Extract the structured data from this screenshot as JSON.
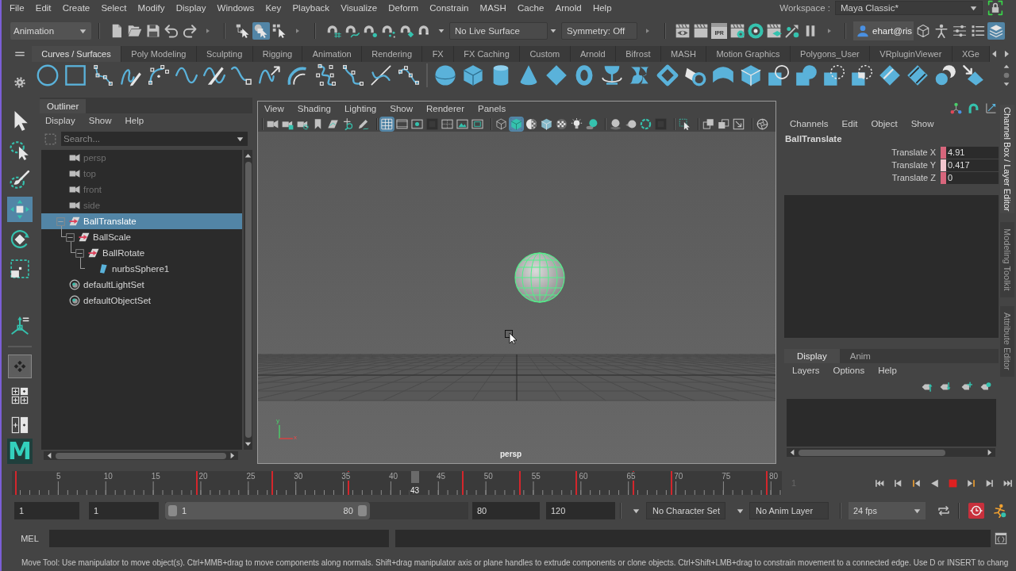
{
  "menu_bar": {
    "items": [
      "File",
      "Edit",
      "Create",
      "Select",
      "Modify",
      "Display",
      "Windows",
      "Key",
      "Playback",
      "Visualize",
      "Deform",
      "Constrain",
      "MASH",
      "Cache",
      "Arnold",
      "Help"
    ],
    "workspace_label": "Workspace :",
    "workspace": "Maya Classic*"
  },
  "status_line": {
    "menu_set": "Animation",
    "selection_modes": [
      {
        "kind": "hierarchy",
        "selected": false
      },
      {
        "kind": "object",
        "selected": true
      },
      {
        "kind": "component",
        "selected": false
      }
    ],
    "live_surface": "No Live Surface",
    "symmetry": "Symmetry: Off",
    "ipr_label": "IPR",
    "user": "ehart@ris",
    "panel_toggles": [
      {
        "kind": "toolkit",
        "selected": false
      },
      {
        "kind": "character",
        "selected": false
      },
      {
        "kind": "attributes",
        "selected": false
      },
      {
        "kind": "settings",
        "selected": false
      },
      {
        "kind": "channels",
        "selected": true
      }
    ]
  },
  "shelf": {
    "tabs": [
      {
        "label": "Curves / Surfaces",
        "selected": true
      },
      {
        "label": "Poly Modeling",
        "selected": false
      },
      {
        "label": "Sculpting",
        "selected": false
      },
      {
        "label": "Rigging",
        "selected": false
      },
      {
        "label": "Animation",
        "selected": false
      },
      {
        "label": "Rendering",
        "selected": false
      },
      {
        "label": "FX",
        "selected": false
      },
      {
        "label": "FX Caching",
        "selected": false
      },
      {
        "label": "Custom",
        "selected": false
      },
      {
        "label": "Arnold",
        "selected": false
      },
      {
        "label": "Bifrost",
        "selected": false
      },
      {
        "label": "MASH",
        "selected": false
      },
      {
        "label": "Motion Graphics",
        "selected": false
      },
      {
        "label": "Polygons_User",
        "selected": false
      },
      {
        "label": "VRpluginViewer",
        "selected": false
      },
      {
        "label": "XGe",
        "selected": false
      }
    ]
  },
  "toolbox": {
    "tools": [
      {
        "kind": "select",
        "selected": false
      },
      {
        "kind": "lasso",
        "selected": false
      },
      {
        "kind": "paint",
        "selected": false
      },
      {
        "kind": "move",
        "selected": true
      },
      {
        "kind": "rotate",
        "selected": false
      },
      {
        "kind": "scale",
        "selected": false
      }
    ],
    "layouts": [
      {
        "kind": "single",
        "selected": true
      },
      {
        "kind": "quad",
        "selected": false
      },
      {
        "kind": "split",
        "selected": false
      }
    ],
    "logo": "M"
  },
  "outliner": {
    "title": "Outliner",
    "menu": [
      "Display",
      "Show",
      "Help"
    ],
    "search": {
      "placeholder": "Search..."
    },
    "tree": [
      {
        "label": "persp",
        "kind": "camera",
        "selected": false,
        "disabled": true,
        "expanded": false
      },
      {
        "label": "top",
        "kind": "camera",
        "selected": false,
        "disabled": true,
        "expanded": false
      },
      {
        "label": "front",
        "kind": "camera",
        "selected": false,
        "disabled": true,
        "expanded": false
      },
      {
        "label": "side",
        "kind": "camera",
        "selected": false,
        "disabled": true,
        "expanded": false
      },
      {
        "label": "BallTranslate",
        "kind": "transform",
        "selected": true,
        "disabled": false,
        "expanded": true,
        "children": [
          {
            "label": "BallScale",
            "kind": "transform",
            "selected": false,
            "disabled": false,
            "expanded": true,
            "children": [
              {
                "label": "BallRotate",
                "kind": "transform",
                "selected": false,
                "disabled": false,
                "expanded": true,
                "children": [
                  {
                    "label": "nurbsSphere1",
                    "kind": "surface",
                    "selected": false,
                    "disabled": false,
                    "expanded": false
                  }
                ]
              }
            ]
          }
        ]
      },
      {
        "label": "defaultLightSet",
        "kind": "set",
        "selected": false,
        "disabled": false,
        "expanded": false
      },
      {
        "label": "defaultObjectSet",
        "kind": "set",
        "selected": false,
        "disabled": false,
        "expanded": false
      }
    ]
  },
  "viewport": {
    "menu": [
      "View",
      "Shading",
      "Lighting",
      "Show",
      "Renderer",
      "Panels"
    ],
    "toolbar": [
      [
        {
          "kind": "camera",
          "selected": false
        },
        {
          "kind": "lock",
          "selected": false
        },
        {
          "kind": "attributes",
          "selected": false
        },
        {
          "kind": "bookmark",
          "selected": false
        },
        {
          "kind": "imageplane",
          "selected": false
        },
        {
          "kind": "panzoom",
          "selected": false
        },
        {
          "kind": "pencil",
          "selected": false
        }
      ],
      [
        {
          "kind": "grid",
          "selected": true
        },
        {
          "kind": "filmgate",
          "selected": false
        },
        {
          "kind": "resgate",
          "selected": false
        },
        {
          "kind": "gatemask",
          "selected": false
        },
        {
          "kind": "fieldchart",
          "selected": false
        },
        {
          "kind": "safeaction",
          "selected": false
        },
        {
          "kind": "safetitle",
          "selected": false
        }
      ],
      [
        {
          "kind": "wireframe",
          "selected": false
        },
        {
          "kind": "shaded",
          "selected": true
        },
        {
          "kind": "material",
          "selected": false
        },
        {
          "kind": "wireshaded",
          "selected": false
        },
        {
          "kind": "textured",
          "selected": false
        },
        {
          "kind": "lights",
          "selected": false
        },
        {
          "kind": "shadows",
          "selected": false
        }
      ],
      [
        {
          "kind": "occlusion",
          "selected": false
        },
        {
          "kind": "blur",
          "selected": false
        },
        {
          "kind": "antialias",
          "selected": false
        },
        {
          "kind": "focus",
          "selected": false
        }
      ],
      [
        {
          "kind": "isolate",
          "selected": false
        }
      ],
      [
        {
          "kind": "xray",
          "selected": false
        },
        {
          "kind": "joints",
          "selected": false
        },
        {
          "kind": "components",
          "selected": false
        }
      ],
      [
        {
          "kind": "aperture",
          "selected": false
        }
      ]
    ],
    "axis_labels": [
      "y",
      "x"
    ],
    "camera": "persp"
  },
  "channel_box": {
    "menu": [
      "Channels",
      "Edit",
      "Object",
      "Show"
    ],
    "node": "BallTranslate",
    "channels": [
      {
        "name": "Translate X",
        "value": "4.91",
        "color": "#d8667c"
      },
      {
        "name": "Translate Y",
        "value": "0.417",
        "color": "#f3c6ce"
      },
      {
        "name": "Translate Z",
        "value": "0",
        "color": "#d8667c"
      }
    ]
  },
  "layer_editor": {
    "tabs": [
      {
        "label": "Display",
        "selected": true
      },
      {
        "label": "Anim",
        "selected": false
      }
    ],
    "menu": [
      "Layers",
      "Options",
      "Help"
    ]
  },
  "side_tabs": [
    {
      "label": "Channel Box / Layer Editor",
      "selected": true
    },
    {
      "label": "Modeling Toolkit",
      "selected": false
    },
    {
      "label": "Attribute Editor",
      "selected": false
    }
  ],
  "time_slider": {
    "ticks": [
      "5",
      "10",
      "15",
      "20",
      "25",
      "30",
      "35",
      "40",
      "45",
      "50",
      "55",
      "60",
      "65",
      "70",
      "75",
      "80"
    ],
    "keys": [
      {
        "level": 0
      },
      {
        "level": 0.2405
      },
      {
        "level": 0.3418
      },
      {
        "level": 0.443
      },
      {
        "level": 0.5949
      },
      {
        "level": 0.6709
      },
      {
        "level": 0.7468
      },
      {
        "level": 0.8228
      },
      {
        "level": 0.8734
      },
      {
        "level": 1
      }
    ],
    "current_frame": {
      "label": "43",
      "level": 0.5316
    },
    "time_field": "1"
  },
  "range_slider": {
    "start": "1",
    "playback_start": "1",
    "range_start_label": "1",
    "range_end_label": "80",
    "level": 0.675,
    "playback_end": "80",
    "end": "120",
    "character_set": "No Character Set",
    "anim_layer": "No Anim Layer",
    "fps": "24 fps",
    "auto_key": true
  },
  "command_line": {
    "language": "MEL"
  },
  "help_line": "Move Tool: Use manipulator to move object(s). Ctrl+MMB+drag to move components along normals. Shift+drag manipulator axis or plane handles to extrude components or clone objects. Ctrl+Shift+LMB+drag to constrain movement to a connected edge. Use D or INSERT to chang"
}
